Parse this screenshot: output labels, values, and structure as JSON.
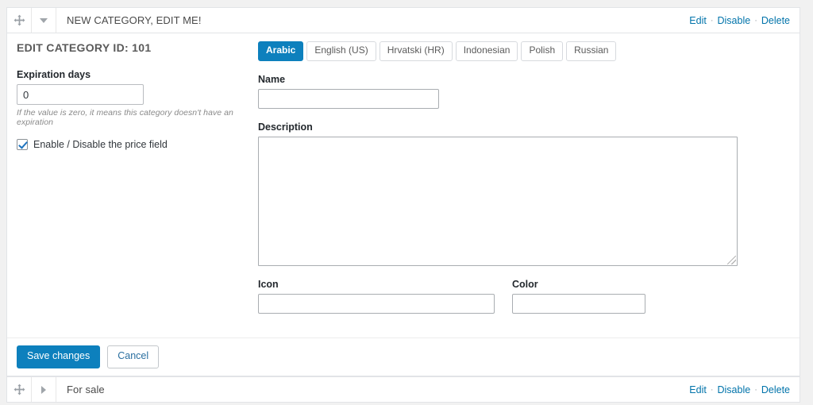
{
  "top_row": {
    "handle_icon": "move-icon",
    "toggle_icon": "triangle-down-icon",
    "title": "NEW CATEGORY, EDIT ME!",
    "actions": {
      "edit": "Edit",
      "disable": "Disable",
      "delete": "Delete",
      "separator": "·"
    }
  },
  "panel": {
    "page_title": "EDIT CATEGORY ID: 101",
    "left": {
      "expiration_label": "Expiration days",
      "expiration_value": "0",
      "expiration_placeholder": "",
      "help_text": "If the value is zero, it means this category doesn't have an expiration",
      "price_field_label": "Enable / Disable the price field",
      "price_field_checked": true
    },
    "tabs": [
      {
        "label": "Arabic",
        "active": true
      },
      {
        "label": "English (US)",
        "active": false
      },
      {
        "label": "Hrvatski (HR)",
        "active": false
      },
      {
        "label": "Indonesian",
        "active": false
      },
      {
        "label": "Polish",
        "active": false
      },
      {
        "label": "Russian",
        "active": false
      }
    ],
    "fields": {
      "name_label": "Name",
      "name_value": "",
      "name_placeholder": "",
      "description_label": "Description",
      "description_value": "",
      "description_placeholder": "",
      "icon_label": "Icon",
      "icon_value": "",
      "icon_placeholder": "",
      "color_label": "Color",
      "color_value": "",
      "color_placeholder": ""
    },
    "footer": {
      "save_label": "Save changes",
      "cancel_label": "Cancel"
    }
  },
  "bottom_row": {
    "handle_icon": "move-icon",
    "toggle_icon": "triangle-right-icon",
    "title": "For sale",
    "actions": {
      "edit": "Edit",
      "disable": "Disable",
      "delete": "Delete",
      "separator": "·"
    }
  },
  "colors": {
    "accent": "#0d80bd",
    "link": "#0073aa",
    "page_bg": "#f1f1f1",
    "panel_bg": "#ffffff",
    "border": "#e2e4e7",
    "muted_text": "#8a8a8a"
  }
}
